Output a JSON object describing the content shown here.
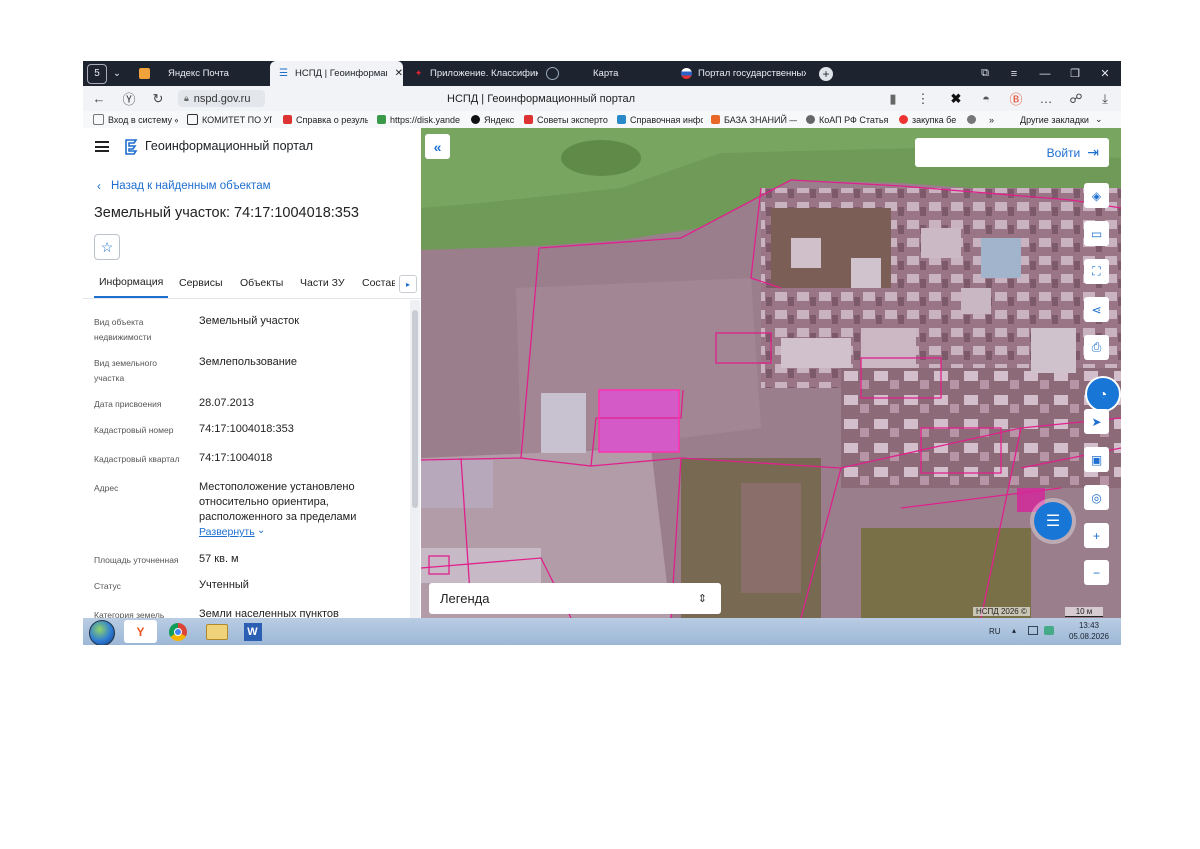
{
  "browser": {
    "tabs": [
      {
        "label": "Яндекс Почта",
        "icon": "mail-icon"
      },
      {
        "label": "НСПД | Геоинформаци",
        "icon": "nspd-icon",
        "active": true
      },
      {
        "label": "Приложение. Классифик",
        "icon": "consultant-icon"
      },
      {
        "label": "Карта",
        "icon": "globe-icon"
      },
      {
        "label": "Портал государственных",
        "icon": "gosuslugi-icon"
      }
    ],
    "url": "nspd.gov.ru",
    "page_title": "НСПД | Геоинформационный портал",
    "bookmarks": [
      "Вход в систему «",
      "КОМИТЕТ ПО УП",
      "Справка о резуль",
      "https://disk.yande",
      "Яндекс",
      "Советы эксперто",
      "Справочная инфо",
      "БАЗА ЗНАНИЙ —",
      "КоАП РФ Статья",
      "закупка бе"
    ],
    "other_bookmarks": "Другие закладки"
  },
  "panel": {
    "portal_name": "Геоинформационный портал",
    "back_link": "Назад к найденным объектам",
    "title": "Земельный участок: 74:17:1004018:353",
    "tabs": [
      "Информация",
      "Сервисы",
      "Объекты",
      "Части ЗУ",
      "Состав"
    ],
    "fields": [
      {
        "label": "Вид объекта недвижимости",
        "value": "Земельный участок"
      },
      {
        "label": "Вид земельного участка",
        "value": "Землепользование"
      },
      {
        "label": "Дата присвоения",
        "value": "28.07.2013"
      },
      {
        "label": "Кадастровый номер",
        "value": "74:17:1004018:353"
      },
      {
        "label": "Кадастровый квартал",
        "value": "74:17:1004018"
      },
      {
        "label": "Адрес",
        "value": "Местоположение установлено относительно ориентира, расположенного за пределами"
      },
      {
        "label": "Площадь уточненная",
        "value": "57 кв. м"
      },
      {
        "label": "Статус",
        "value": "Учтенный"
      },
      {
        "label": "Категория земель",
        "value": "Земли населенных пунктов"
      }
    ],
    "expand_link": "Развернуть"
  },
  "map": {
    "login_label": "Войти",
    "legend_label": "Легенда",
    "attribution": "НСПД 2026 ©",
    "scale_label": "10 м",
    "accent": "#1e6fd0",
    "parcel_color": "#e0208c"
  },
  "taskbar": {
    "lang": "RU",
    "time": "13:43",
    "date": "05.08.2026"
  }
}
